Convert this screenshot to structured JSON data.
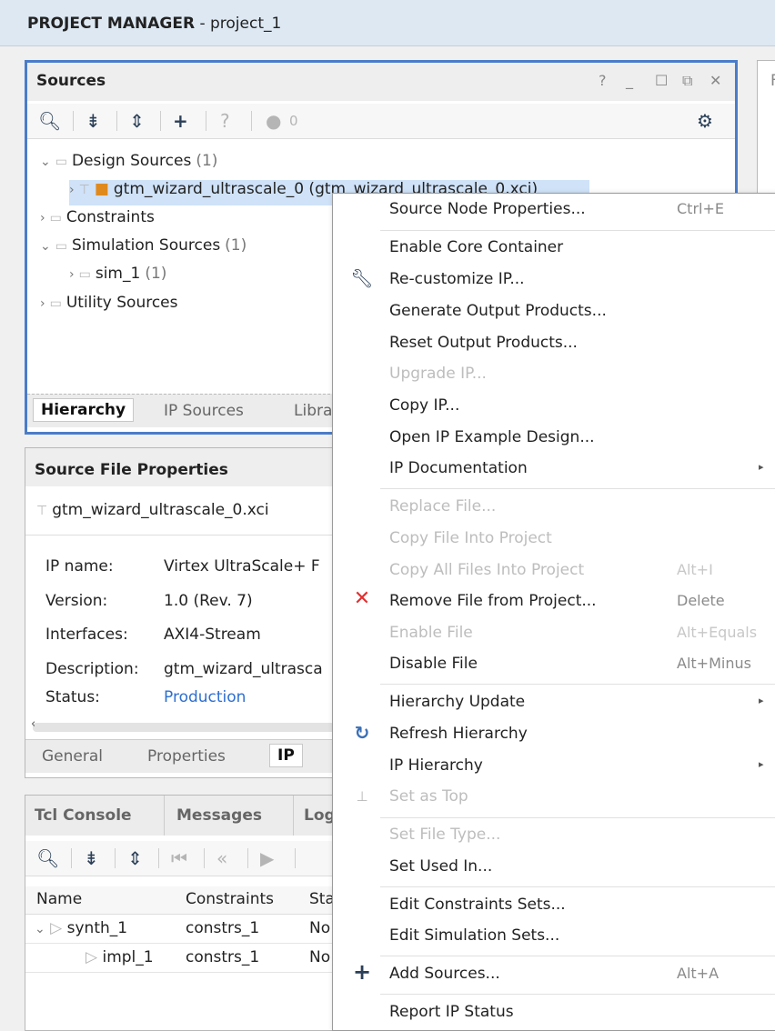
{
  "header": {
    "title_bold": "PROJECT MANAGER",
    "title_rest": " - project_1"
  },
  "sources": {
    "title": "Sources",
    "window_controls": [
      "?",
      "_",
      "☐",
      "⧉",
      "✕"
    ],
    "toolbar": {
      "badge_count": "0"
    },
    "tree": {
      "design_sources": {
        "label": "Design Sources",
        "count": "(1)"
      },
      "ip_item": {
        "label": "gtm_wizard_ultrascale_0 (gtm_wizard_ultrascale_0.xci)"
      },
      "constraints": {
        "label": "Constraints"
      },
      "simulation_sources": {
        "label": "Simulation Sources",
        "count": "(1)"
      },
      "sim_1": {
        "label": "sim_1",
        "count": "(1)"
      },
      "utility_sources": {
        "label": "Utility Sources"
      }
    },
    "tabs": [
      "Hierarchy",
      "IP Sources",
      "Libra"
    ]
  },
  "source_file_properties": {
    "title": "Source File Properties",
    "file": "gtm_wizard_ultrascale_0.xci",
    "props": [
      {
        "key": "IP name:",
        "value": "Virtex UltraScale+ F"
      },
      {
        "key": "Version:",
        "value": "1.0 (Rev. 7)"
      },
      {
        "key": "Interfaces:",
        "value": "AXI4-Stream"
      },
      {
        "key": "Description:",
        "value": "gtm_wizard_ultrasca"
      },
      {
        "key": "Status:",
        "value": "Production"
      }
    ],
    "tabs": [
      "General",
      "Properties",
      "IP"
    ]
  },
  "console": {
    "tabs": [
      "Tcl Console",
      "Messages",
      "Log"
    ],
    "columns": [
      "Name",
      "Constraints",
      "Sta"
    ],
    "rows": [
      {
        "name": "synth_1",
        "constraints": "constrs_1",
        "status": "No"
      },
      {
        "name": "impl_1",
        "constraints": "constrs_1",
        "status": "No"
      }
    ]
  },
  "context_menu": {
    "items": [
      {
        "label": "Source Node Properties...",
        "shortcut": "Ctrl+E",
        "disabled": false,
        "icon": ""
      },
      {
        "label": "Enable Core Container",
        "shortcut": "",
        "disabled": false,
        "icon": ""
      },
      {
        "label": "Re-customize IP...",
        "shortcut": "",
        "disabled": false,
        "icon": "wrench-icon"
      },
      {
        "label": "Generate Output Products...",
        "shortcut": "",
        "disabled": false,
        "icon": ""
      },
      {
        "label": "Reset Output Products...",
        "shortcut": "",
        "disabled": false,
        "icon": ""
      },
      {
        "label": "Upgrade IP...",
        "shortcut": "",
        "disabled": true,
        "icon": ""
      },
      {
        "label": "Copy IP...",
        "shortcut": "",
        "disabled": false,
        "icon": ""
      },
      {
        "label": "Open IP Example Design...",
        "shortcut": "",
        "disabled": false,
        "icon": ""
      },
      {
        "label": "IP Documentation",
        "shortcut": "",
        "disabled": false,
        "icon": "",
        "submenu": true
      },
      {
        "label": "Replace File...",
        "shortcut": "",
        "disabled": true,
        "icon": ""
      },
      {
        "label": "Copy File Into Project",
        "shortcut": "",
        "disabled": true,
        "icon": ""
      },
      {
        "label": "Copy All Files Into Project",
        "shortcut": "Alt+I",
        "disabled": true,
        "icon": ""
      },
      {
        "label": "Remove File from Project...",
        "shortcut": "Delete",
        "disabled": false,
        "icon": "remove-x-icon"
      },
      {
        "label": "Enable File",
        "shortcut": "Alt+Equals",
        "disabled": true,
        "icon": ""
      },
      {
        "label": "Disable File",
        "shortcut": "Alt+Minus",
        "disabled": false,
        "icon": ""
      },
      {
        "label": "Hierarchy Update",
        "shortcut": "",
        "disabled": false,
        "icon": "",
        "submenu": true
      },
      {
        "label": "Refresh Hierarchy",
        "shortcut": "",
        "disabled": false,
        "icon": "refresh-icon"
      },
      {
        "label": "IP Hierarchy",
        "shortcut": "",
        "disabled": false,
        "icon": "",
        "submenu": true
      },
      {
        "label": "Set as Top",
        "shortcut": "",
        "disabled": true,
        "icon": "hierarchy-icon"
      },
      {
        "label": "Set File Type...",
        "shortcut": "",
        "disabled": true,
        "icon": ""
      },
      {
        "label": "Set Used In...",
        "shortcut": "",
        "disabled": false,
        "icon": ""
      },
      {
        "label": "Edit Constraints Sets...",
        "shortcut": "",
        "disabled": false,
        "icon": ""
      },
      {
        "label": "Edit Simulation Sets...",
        "shortcut": "",
        "disabled": false,
        "icon": ""
      },
      {
        "label": "Add Sources...",
        "shortcut": "Alt+A",
        "disabled": false,
        "icon": "plus-icon"
      },
      {
        "label": "Report IP Status",
        "shortcut": "",
        "disabled": false,
        "icon": ""
      }
    ]
  },
  "colors": {
    "accent": "#4a7cc9",
    "remove_icon": "#e23030",
    "refresh_icon": "#3b6fb6",
    "link": "#2e6fd1"
  }
}
